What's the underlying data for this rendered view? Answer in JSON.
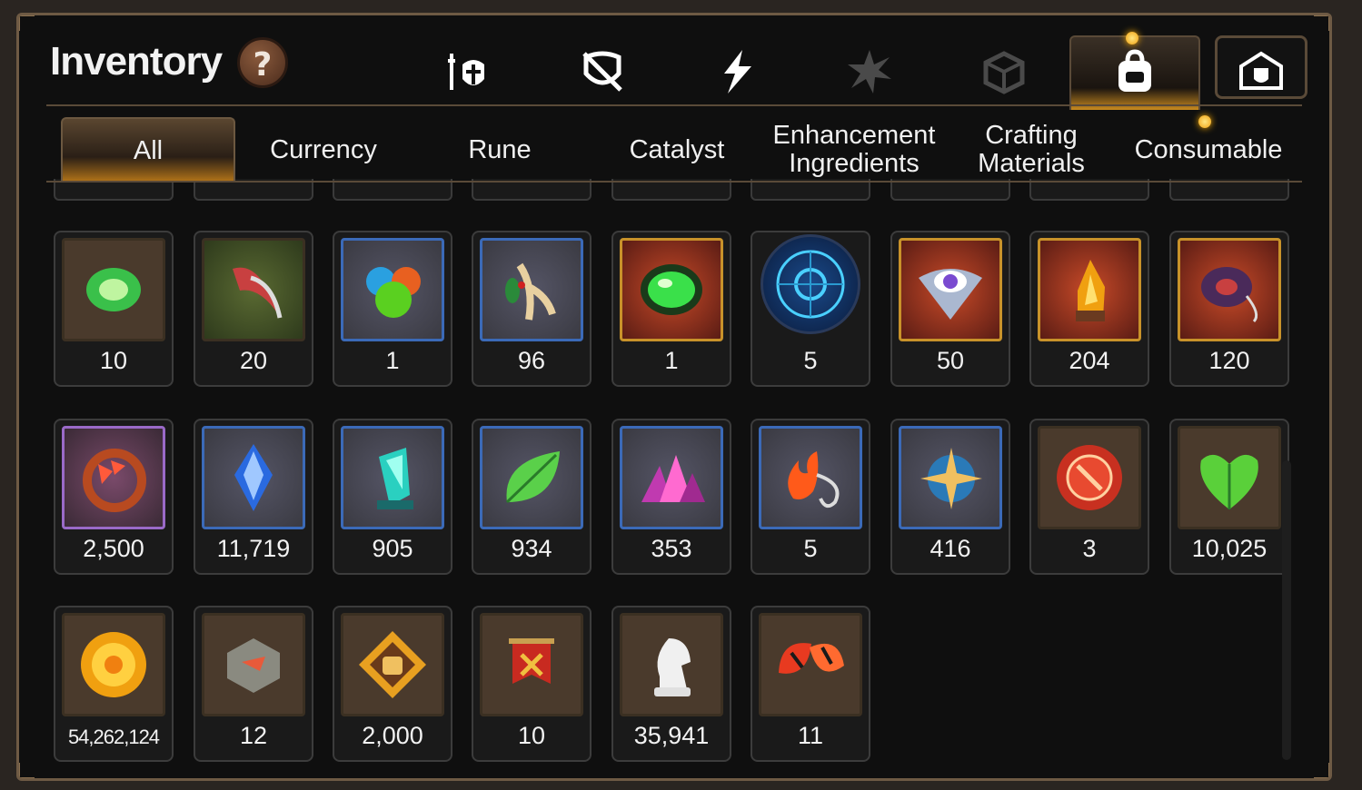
{
  "title": "Inventory",
  "help_label": "?",
  "top_icons": [
    "gear-equipment-icon",
    "artifact-icon",
    "lightning-icon",
    "starburst-icon",
    "crystal-box-icon",
    "bag-icon",
    "guild-shield-icon"
  ],
  "tabs": [
    "All",
    "Currency",
    "Rune",
    "Catalyst",
    "Enhancement Ingredients",
    "Crafting Materials",
    "Consumable"
  ],
  "active_tab": "All",
  "items": [
    {
      "count": "10",
      "icon": "green-charm-icon",
      "frame": "plain"
    },
    {
      "count": "20",
      "icon": "claw-icon",
      "frame": "green"
    },
    {
      "count": "1",
      "icon": "orbs-icon",
      "frame": "blue"
    },
    {
      "count": "96",
      "icon": "root-icon",
      "frame": "blue"
    },
    {
      "count": "1",
      "icon": "green-gem-icon",
      "frame": "red"
    },
    {
      "count": "5",
      "icon": "blue-rune-disc-icon",
      "frame": "round"
    },
    {
      "count": "50",
      "icon": "eye-icon",
      "frame": "red"
    },
    {
      "count": "204",
      "icon": "flame-crystal-icon",
      "frame": "red"
    },
    {
      "count": "120",
      "icon": "ring-icon",
      "frame": "red"
    },
    {
      "count": "2,500",
      "icon": "hourglass-ring-icon",
      "frame": "purple"
    },
    {
      "count": "11,719",
      "icon": "blue-crystal-icon",
      "frame": "blue"
    },
    {
      "count": "905",
      "icon": "teal-crystal-icon",
      "frame": "blue"
    },
    {
      "count": "934",
      "icon": "leaf-icon",
      "frame": "blue"
    },
    {
      "count": "353",
      "icon": "pink-crystals-icon",
      "frame": "blue"
    },
    {
      "count": "5",
      "icon": "fire-amulet-icon",
      "frame": "blue"
    },
    {
      "count": "416",
      "icon": "star-amulet-icon",
      "frame": "blue"
    },
    {
      "count": "3",
      "icon": "red-badge-icon",
      "frame": "plain"
    },
    {
      "count": "10,025",
      "icon": "heart-leaf-icon",
      "frame": "plain"
    },
    {
      "count": "54,262,124",
      "icon": "gold-coin-icon",
      "frame": "plain",
      "small": true
    },
    {
      "count": "12",
      "icon": "stone-icon",
      "frame": "plain"
    },
    {
      "count": "2,000",
      "icon": "fist-emblem-icon",
      "frame": "plain"
    },
    {
      "count": "10",
      "icon": "banner-icon",
      "frame": "plain"
    },
    {
      "count": "35,941",
      "icon": "knight-chess-icon",
      "frame": "plain"
    },
    {
      "count": "11",
      "icon": "red-leaves-icon",
      "frame": "plain"
    }
  ]
}
